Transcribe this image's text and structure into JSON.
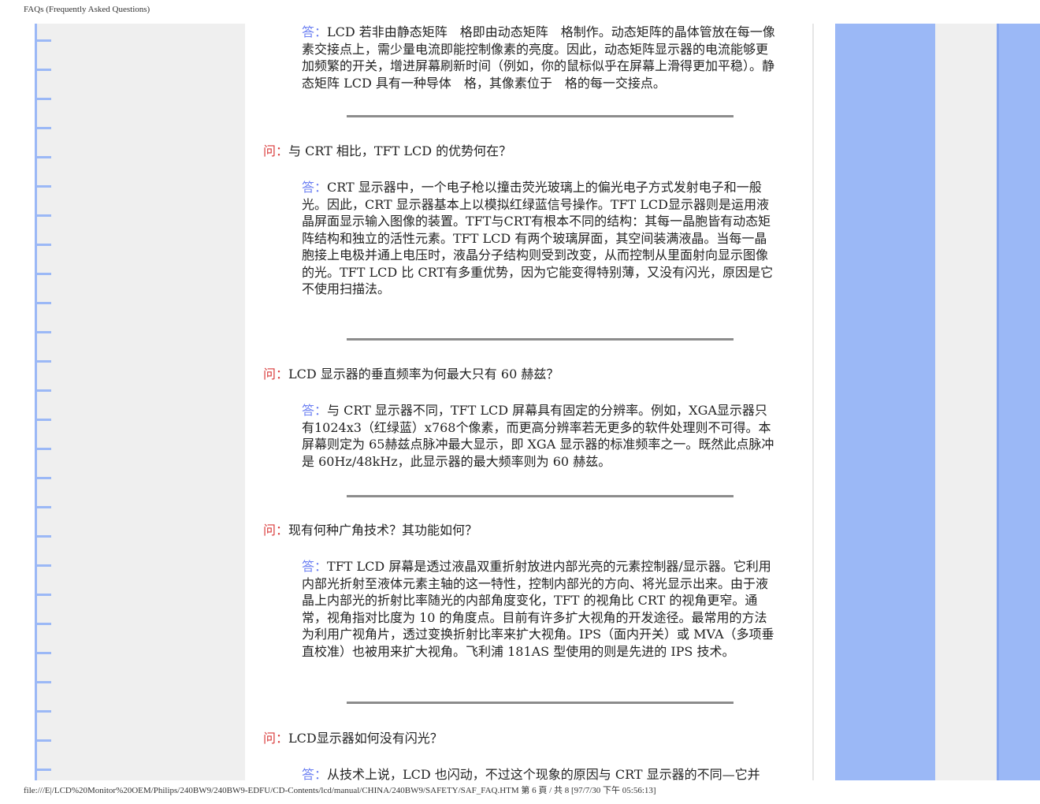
{
  "header": {
    "title": "FAQs (Frequently Asked Questions)"
  },
  "footer": {
    "path": "file:///E|/LCD%20Monitor%20OEM/Philips/240BW9/240BW9-EDFU/CD-Contents/lcd/manual/CHINA/240BW9/SAFETY/SAF_FAQ.HTM 第 6 頁 / 共 8  [97/7/30 下午 05:56:13]"
  },
  "labels": {
    "question": "问：",
    "answer": "答："
  },
  "faq": [
    {
      "answer": "LCD 若非由静态矩阵　格即由动态矩阵　格制作。动态矩阵的晶体管放在每一像素交接点上，需少量电流即能控制像素的亮度。因此，动态矩阵显示器的电流能够更加频繁的开关，增进屏幕刷新时间（例如，你的鼠标似乎在屏幕上滑得更加平稳）。静态矩阵 LCD 具有一种导体　格，其像素位于　格的每一交接点。"
    },
    {
      "question": "与 CRT 相比，TFT LCD 的优势何在？",
      "answer": "CRT 显示器中，一个电子枪以撞击荧光玻璃上的偏光电子方式发射电子和一般光。因此，CRT 显示器基本上以模拟红绿蓝信号操作。TFT LCD显示器则是运用液晶屏面显示输入图像的装置。TFT与CRT有根本不同的结构：其每一晶胞皆有动态矩阵结构和独立的活性元素。TFT LCD 有两个玻璃屏面，其空间装满液晶。当每一晶胞接上电极并通上电压时，液晶分子结构则受到改变，从而控制从里面射向显示图像的光。TFT LCD 比 CRT有多重优势，因为它能变得特别薄，又没有闪光，原因是它不使用扫描法。"
    },
    {
      "question": "LCD 显示器的垂直频率为何最大只有 60 赫兹？",
      "answer": "与 CRT 显示器不同，TFT LCD 屏幕具有固定的分辨率。例如，XGA显示器只有1024x3（红绿蓝）x768个像素，而更高分辨率若无更多的软件处理则不可得。本屏幕则定为 65赫兹点脉冲最大显示，即 XGA 显示器的标准频率之一。既然此点脉冲是 60Hz/48kHz，此显示器的最大频率则为 60 赫兹。"
    },
    {
      "question": "现有何种广角技术？其功能如何？",
      "answer": "TFT LCD 屏幕是透过液晶双重折射放进内部光亮的元素控制器/显示器。它利用内部光折射至液体元素主轴的这一特性，控制内部光的方向、将光显示出来。由于液晶上内部光的折射比率随光的内部角度变化，TFT 的视角比 CRT 的视角更窄。通常，视角指对比度为 10 的角度点。目前有许多扩大视角的开发途径。最常用的方法为利用广视角片，透过变换折射比率来扩大视角。IPS（面内开关）或 MVA（多项垂直校准）也被用来扩大视角。飞利浦 181AS 型使用的则是先进的 IPS 技术。"
    },
    {
      "question": "LCD显示器如何没有闪光？",
      "answer": "从技术上说，LCD 也闪动，不过这个现象的原因与 CRT 显示器的不同—它并"
    }
  ],
  "colors": {
    "question_label": "#d93a3a",
    "answer_label": "#6b7ff2",
    "rail_blue": "#9bb8f6",
    "panel_gray": "#efefef"
  }
}
